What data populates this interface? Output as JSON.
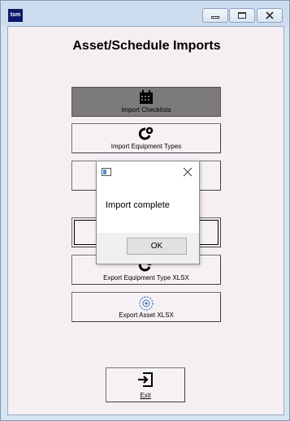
{
  "window": {
    "app_icon_text": "tsm",
    "controls": {
      "minimize_icon": "minimize-icon",
      "maximize_icon": "maximize-icon",
      "close_icon": "close-icon"
    }
  },
  "page": {
    "title": "Asset/Schedule Imports"
  },
  "buttons": [
    {
      "label": "Import Checklists",
      "icon": "calendar-icon",
      "state": "pressed"
    },
    {
      "label": "Import Equipment Types",
      "icon": "equipment-type-icon"
    },
    {
      "label": "",
      "icon": ""
    },
    {
      "label": "",
      "icon": "",
      "state": "focused"
    },
    {
      "label": "Export Equipment Type XLSX",
      "icon": "equipment-type-icon"
    },
    {
      "label": "Export Asset XLSX",
      "icon": "asset-icon"
    }
  ],
  "exit": {
    "label": "Exit",
    "icon": "exit-icon"
  },
  "dialog": {
    "message": "Import complete",
    "ok_label": "OK"
  },
  "colors": {
    "client_bg": "#f5eff4",
    "pressed_button": "#7c7a7b",
    "frame": "#d7e4f2"
  }
}
